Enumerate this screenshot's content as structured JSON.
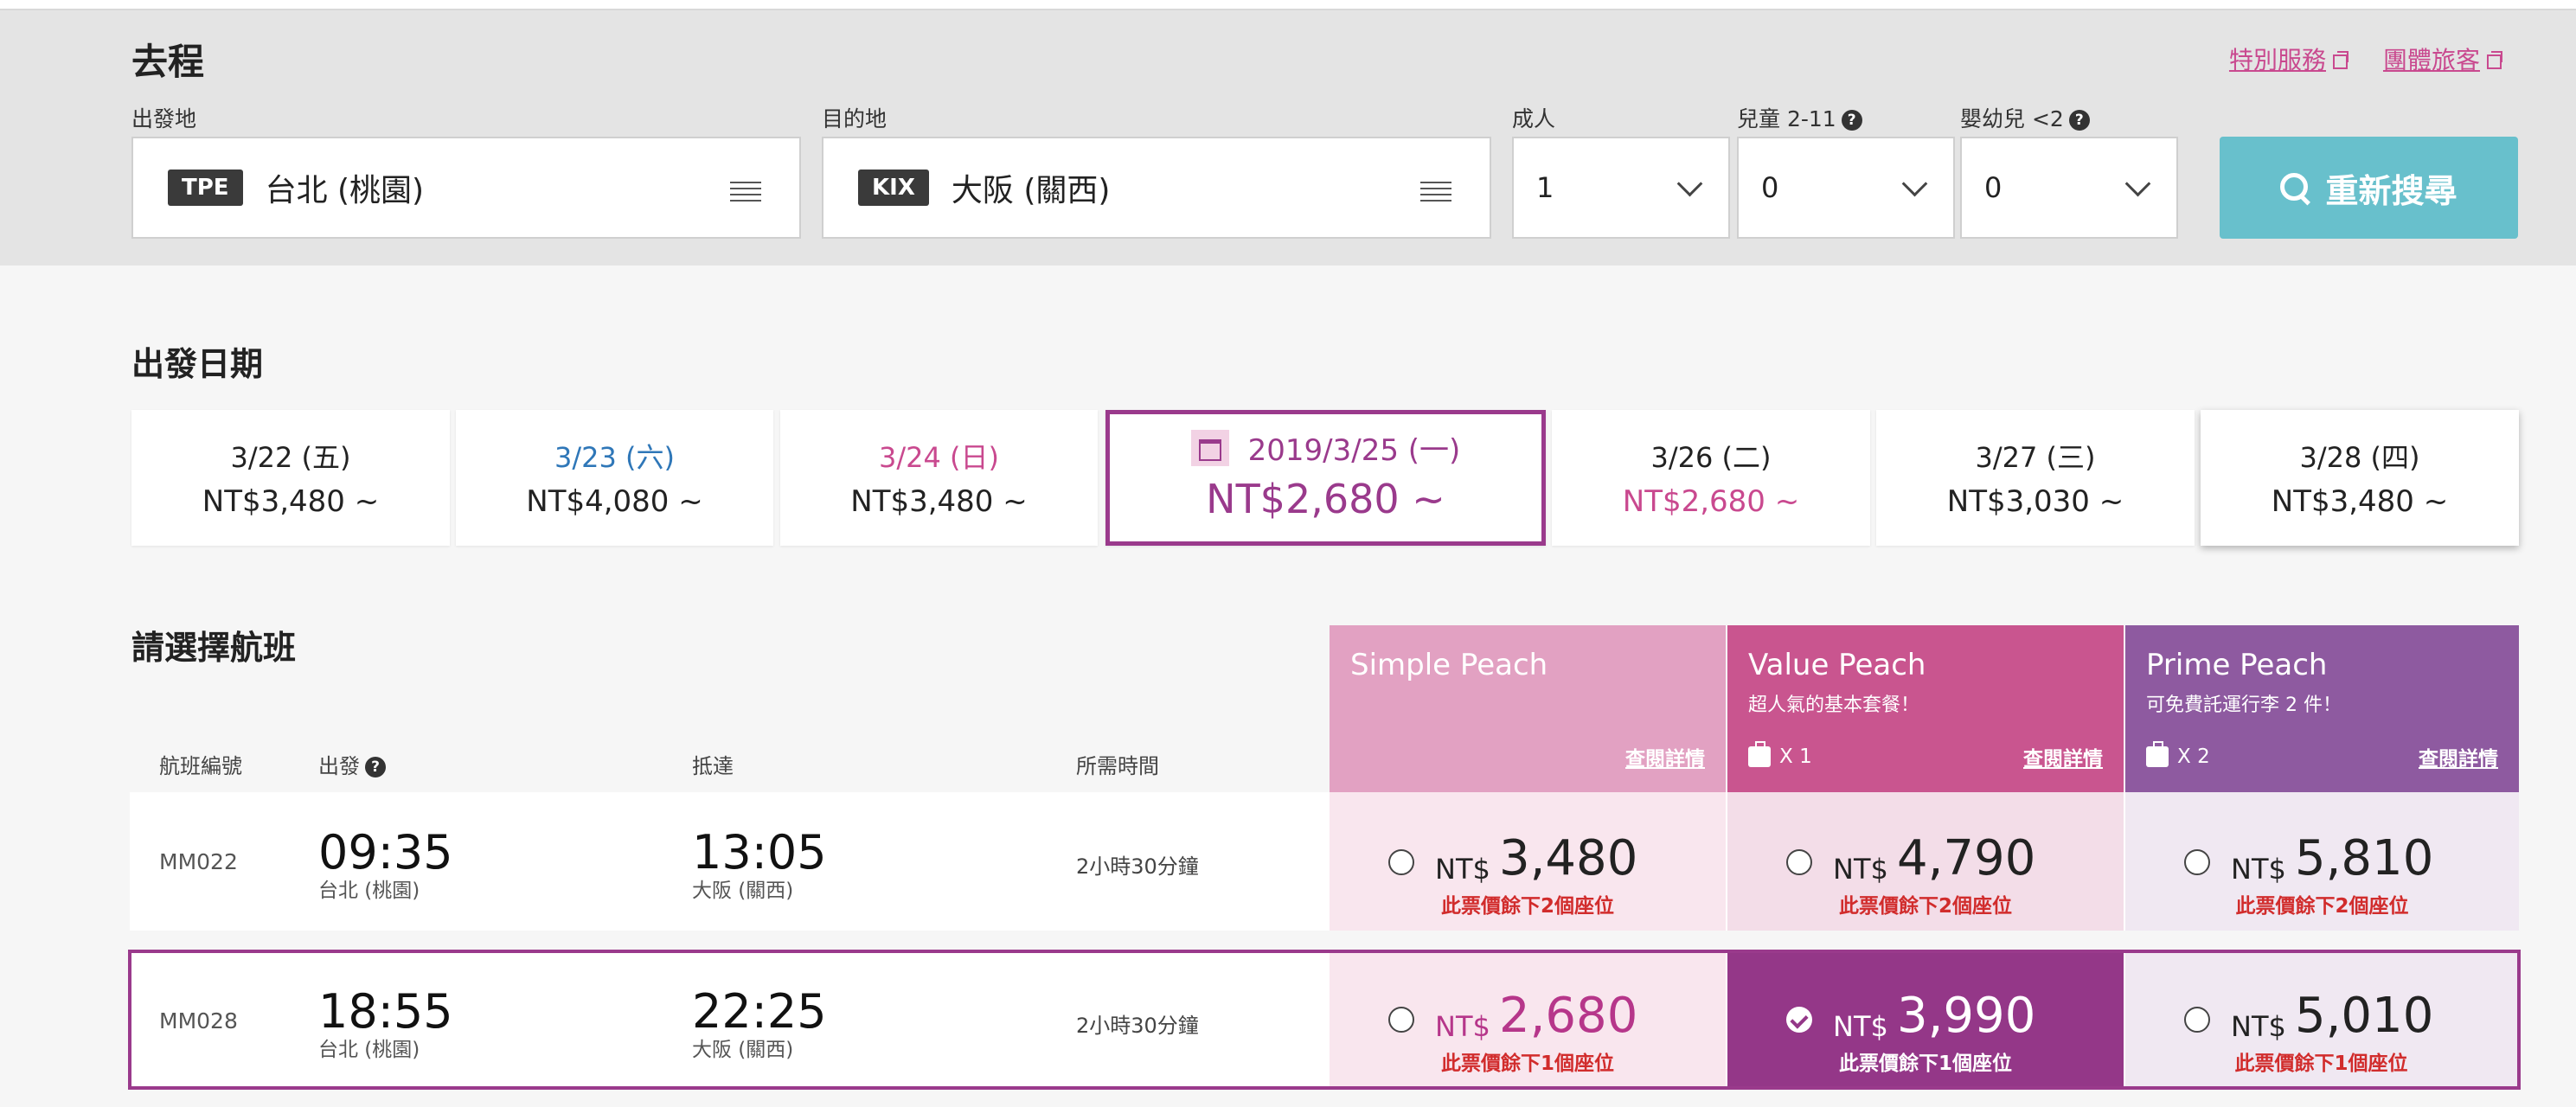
{
  "header": {
    "title": "去程",
    "links": [
      "特別服務",
      "團體旅客"
    ]
  },
  "search": {
    "origin_label": "出發地",
    "origin_code": "TPE",
    "origin_name": "台北 (桃園)",
    "destination_label": "目的地",
    "destination_code": "KIX",
    "destination_name": "大阪 (關西)",
    "adult_label": "成人",
    "adult_value": "1",
    "child_label": "兒童 2-11",
    "child_value": "0",
    "infant_label": "嬰幼兒 <2",
    "infant_value": "0",
    "help_glyph": "?",
    "search_button": "重新搜尋"
  },
  "dates": {
    "title": "出發日期",
    "items": [
      {
        "date": "3/22 (五)",
        "price": "NT$3,480 ~"
      },
      {
        "date": "3/23 (六)",
        "price": "NT$4,080 ~"
      },
      {
        "date": "3/24 (日)",
        "price": "NT$3,480 ~"
      },
      {
        "date": "2019/3/25 (一)",
        "price": "NT$2,680 ~"
      },
      {
        "date": "3/26 (二)",
        "price": "NT$2,680 ~"
      },
      {
        "date": "3/27 (三)",
        "price": "NT$3,030 ~"
      },
      {
        "date": "3/28 (四)",
        "price": "NT$3,480 ~"
      }
    ]
  },
  "flights": {
    "title": "請選擇航班",
    "columns": {
      "flight_no": "航班編號",
      "depart": "出發",
      "arrive": "抵達",
      "duration": "所需時間"
    },
    "plans": [
      {
        "name": "Simple Peach",
        "sub": "",
        "bag": "",
        "link": "查閱詳情"
      },
      {
        "name": "Value Peach",
        "sub": "超人氣的基本套餐！",
        "bag": "X 1",
        "link": "查閱詳情"
      },
      {
        "name": "Prime Peach",
        "sub": "可免費託運行李 2 件！",
        "bag": "X 2",
        "link": "查閱詳情"
      }
    ],
    "currency": "NT$",
    "rows": [
      {
        "flight_no": "MM022",
        "dep_time": "09:35",
        "dep_city": "台北 (桃園)",
        "arr_time": "13:05",
        "arr_city": "大阪 (關西)",
        "duration": "2小時30分鐘",
        "fares": [
          {
            "amount": "3,480",
            "seats": "此票價餘下2個座位"
          },
          {
            "amount": "4,790",
            "seats": "此票價餘下2個座位"
          },
          {
            "amount": "5,810",
            "seats": "此票價餘下2個座位"
          }
        ]
      },
      {
        "flight_no": "MM028",
        "dep_time": "18:55",
        "dep_city": "台北 (桃園)",
        "arr_time": "22:25",
        "arr_city": "大阪 (關西)",
        "duration": "2小時30分鐘",
        "fares": [
          {
            "amount": "2,680",
            "seats": "此票價餘下1個座位"
          },
          {
            "amount": "3,990",
            "seats": "此票價餘下1個座位"
          },
          {
            "amount": "5,010",
            "seats": "此票價餘下1個座位"
          }
        ]
      }
    ]
  },
  "colors": {
    "accent_purple": "#9a3a8c",
    "peach_pink": "#c9498f",
    "simple_peach": "#e2a1c2",
    "value_peach": "#c9558f",
    "prime_peach": "#8e5aa0",
    "search_button": "#68c0cc",
    "seat_warning": "#d12c2c"
  }
}
